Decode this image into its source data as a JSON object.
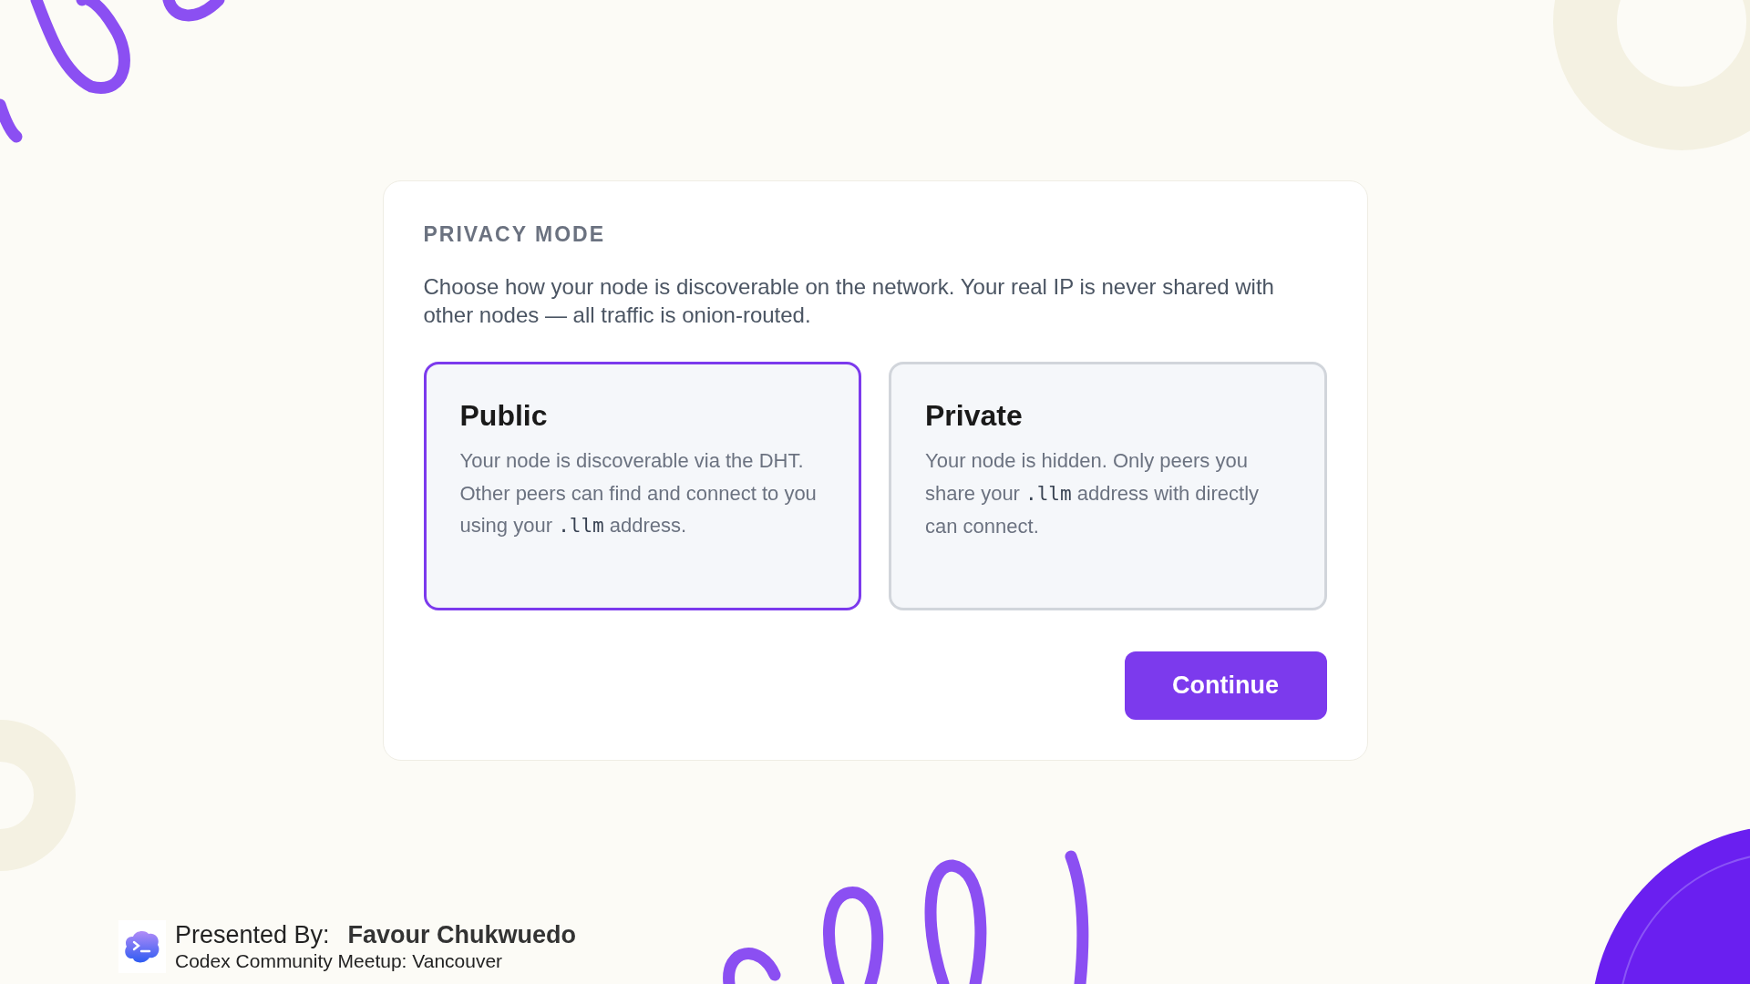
{
  "card": {
    "heading": "PRIVACY MODE",
    "intro": "Choose how your node is discoverable on the network. Your real IP is never shared with other nodes — all traffic is onion-routed.",
    "options": [
      {
        "title": "Public",
        "selected": true,
        "description": [
          {
            "kind": "text",
            "text": "Your node is discoverable via the DHT. Other peers can find and connect to you using your "
          },
          {
            "kind": "code",
            "text": ".llm"
          },
          {
            "kind": "text",
            "text": " address."
          }
        ]
      },
      {
        "title": "Private",
        "selected": false,
        "description": [
          {
            "kind": "text",
            "text": "Your node is hidden. Only peers you share your "
          },
          {
            "kind": "code",
            "text": ".llm"
          },
          {
            "kind": "text",
            "text": " address with directly can connect."
          }
        ]
      }
    ],
    "button": "Continue"
  },
  "footer": {
    "label": "Presented By:",
    "presenter": "Favour Chukwuedo",
    "event": "Codex Community Meetup: Vancouver"
  }
}
